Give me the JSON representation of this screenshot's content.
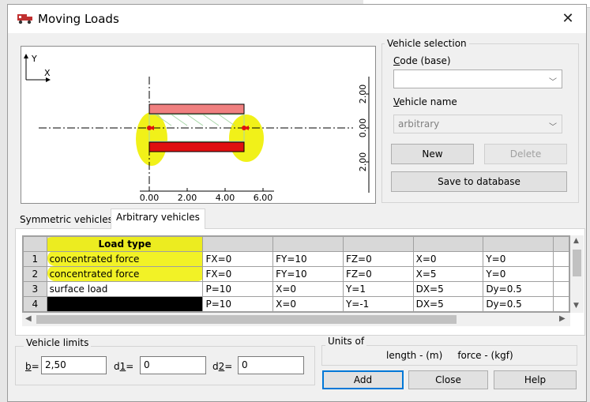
{
  "window": {
    "title": "Moving Loads",
    "close_glyph": "✕"
  },
  "preview": {
    "y_axis": "Y",
    "x_axis": "X",
    "x_ticks": [
      "0.00",
      "2.00",
      "4.00",
      "6.00"
    ],
    "y_ticks": [
      "2.00",
      "0.00",
      "2.00"
    ]
  },
  "vehicle_selection": {
    "legend": "Vehicle selection",
    "code_label": "Code (base)",
    "code_value": "",
    "name_label": "Vehicle name",
    "name_value": "arbitrary",
    "new_label": "New",
    "delete_label": "Delete",
    "save_label": "Save to database"
  },
  "tabs": [
    "Symmetric vehicles",
    "Arbitrary vehicles"
  ],
  "active_tab": "Arbitrary vehicles",
  "load_grid": {
    "header": "Load type",
    "rows": [
      {
        "n": "1",
        "type": "concentrated force",
        "c1": "FX=0",
        "c2": "FY=10",
        "c3": "FZ=0",
        "c4": "X=0",
        "c5": "Y=0"
      },
      {
        "n": "2",
        "type": "concentrated force",
        "c1": "FX=0",
        "c2": "FY=10",
        "c3": "FZ=0",
        "c4": "X=5",
        "c5": "Y=0"
      },
      {
        "n": "3",
        "type": "surface load",
        "c1": "P=10",
        "c2": "X=0",
        "c3": "Y=1",
        "c4": "DX=5",
        "c5": "Dy=0.5"
      },
      {
        "n": "4",
        "type": "",
        "c1": "P=10",
        "c2": "X=0",
        "c3": "Y=-1",
        "c4": "DX=5",
        "c5": "Dy=0.5"
      }
    ]
  },
  "vehicle_limits": {
    "legend": "Vehicle limits",
    "b_label": "b=",
    "b_value": "2,50",
    "d1_label": "d1=",
    "d1_value": "0",
    "d2_label": "d2=",
    "d2_value": "0"
  },
  "units": {
    "legend": "Units of",
    "text": "length - (m)     force - (kgf)"
  },
  "buttons": {
    "add": "Add",
    "close": "Close",
    "help": "Help"
  },
  "colors": {
    "highlight": "#f0f000",
    "accent": "#0078d7"
  }
}
